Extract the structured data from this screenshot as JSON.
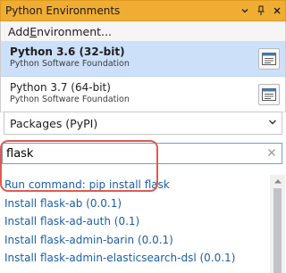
{
  "window": {
    "title": "Python Environments",
    "dropdown_icon": "chevron-down-icon",
    "pin_icon": "pin-icon",
    "close_icon": "close-icon"
  },
  "add_environment": {
    "prefix": "Add ",
    "underlined": "E",
    "suffix": "nvironment..."
  },
  "environments": [
    {
      "name": "Python 3.6 (32-bit)",
      "publisher": "Python Software Foundation",
      "selected": true
    },
    {
      "name": "Python 3.7 (64-bit)",
      "publisher": "Python Software Foundation",
      "selected": false
    }
  ],
  "packages_select": {
    "value": "Packages (PyPI)"
  },
  "search": {
    "value": "flask",
    "clear_icon": "clear-icon"
  },
  "results": [
    "Run command: pip install flask",
    "Install flask-ab (0.0.1)",
    "Install flask-ad-auth (0.1)",
    "Install flask-admin-barin (0.0.1)",
    "Install flask-admin-elasticsearch-dsl (0.0.1)"
  ],
  "colors": {
    "titlebar": "#f0ad33",
    "selected_env": "#cce0f9",
    "link": "#1a5ea8",
    "highlight": "#e05a4e"
  }
}
